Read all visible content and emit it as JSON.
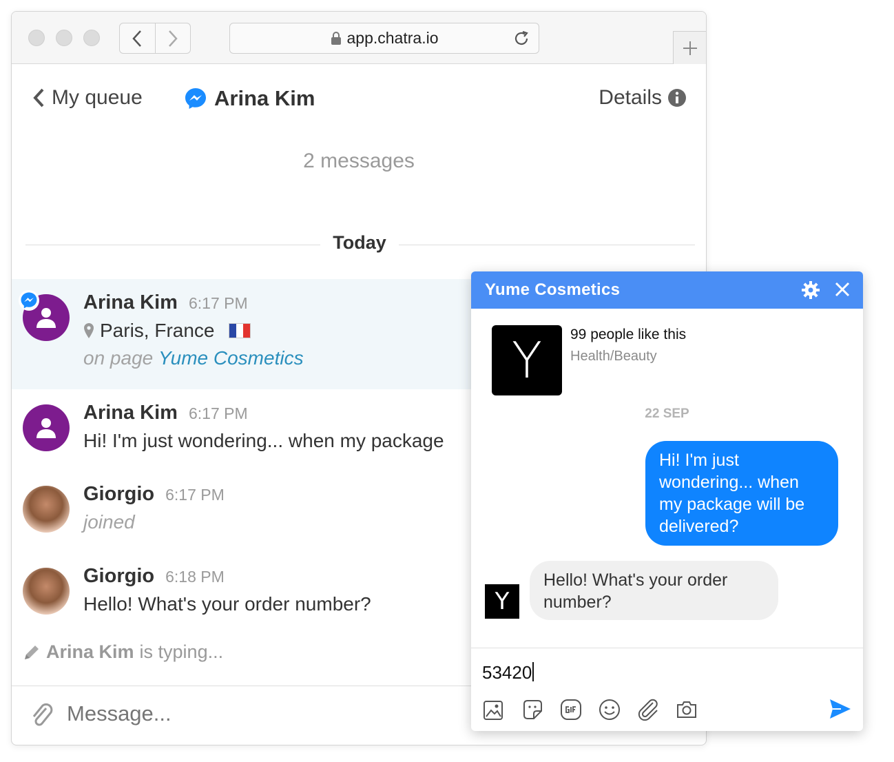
{
  "browser": {
    "url": "app.chatra.io",
    "chat": {
      "back_label": "My queue",
      "contact_name": "Arina Kim",
      "details_label": "Details",
      "message_count": "2 messages",
      "day_label": "Today",
      "entries": [
        {
          "name": "Arina Kim",
          "time": "6:17 PM",
          "location": "Paris, France",
          "page_prefix": "on page",
          "page_name": "Yume Cosmetics"
        },
        {
          "name": "Arina Kim",
          "time": "6:17 PM",
          "text": "Hi! I'm just wondering... when my package"
        },
        {
          "name": "Giorgio",
          "time": "6:17 PM",
          "text": "joined"
        },
        {
          "name": "Giorgio",
          "time": "6:18 PM",
          "text": "Hello! What's your order number?"
        }
      ],
      "typing_name": "Arina Kim",
      "typing_suffix": "is typing...",
      "composer_placeholder": "Message..."
    }
  },
  "messenger": {
    "page_title": "Yume Cosmetics",
    "logo_letter": "Y",
    "likes": "99 people like this",
    "category": "Health/Beauty",
    "date": "22 SEP",
    "outgoing": "Hi! I'm just wondering... when my package will be delivered?",
    "incoming": "Hello! What's your order number?",
    "input_value": "53420"
  },
  "colors": {
    "messenger_blue": "#4a8ef5",
    "bubble_blue": "#0f84ff",
    "avatar_purple": "#7d1c8e",
    "link_blue": "#2a8fbd",
    "highlight_bg": "#f1f7fa"
  },
  "icons": [
    "lock-icon",
    "reload-icon",
    "plus-icon",
    "chevron-left-icon",
    "chevron-right-icon",
    "messenger-icon",
    "info-icon",
    "location-pin-icon",
    "france-flag-icon",
    "user-icon",
    "pencil-icon",
    "paperclip-icon",
    "gear-icon",
    "close-icon",
    "image-icon",
    "sticker-icon",
    "gif-icon",
    "emoji-icon",
    "attachment-icon",
    "camera-icon",
    "send-icon"
  ]
}
